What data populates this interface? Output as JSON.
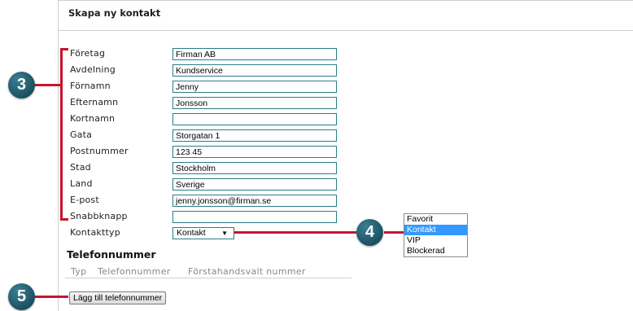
{
  "form": {
    "title": "Skapa ny kontakt",
    "fields": [
      {
        "label": "Företag",
        "value": "Firman AB"
      },
      {
        "label": "Avdelning",
        "value": "Kundservice"
      },
      {
        "label": "Förnamn",
        "value": "Jenny"
      },
      {
        "label": "Efternamn",
        "value": "Jonsson"
      },
      {
        "label": "Kortnamn",
        "value": ""
      },
      {
        "label": "Gata",
        "value": "Storgatan 1"
      },
      {
        "label": "Postnummer",
        "value": "123 45"
      },
      {
        "label": "Stad",
        "value": "Stockholm"
      },
      {
        "label": "Land",
        "value": "Sverige"
      },
      {
        "label": "E-post",
        "value": "jenny.jonsson@firman.se"
      },
      {
        "label": "Snabbknapp",
        "value": ""
      }
    ],
    "contact_type": {
      "label": "Kontakttyp",
      "selected": "Kontakt"
    }
  },
  "dropdown": {
    "options": [
      "Favorit",
      "Kontakt",
      "VIP",
      "Blockerad"
    ],
    "highlighted": "Kontakt"
  },
  "phone": {
    "heading": "Telefonnummer",
    "columns": [
      "Typ",
      "Telefonnummer",
      "Förstahandsvalt nummer"
    ],
    "add_button": "Lägg till telefonnummer"
  },
  "callouts": [
    "3",
    "4",
    "5"
  ],
  "colors": {
    "callout_line": "#c8132e",
    "callout_badge": "#1f5a6c",
    "input_border": "#2a7d88",
    "highlight": "#3399ff"
  }
}
